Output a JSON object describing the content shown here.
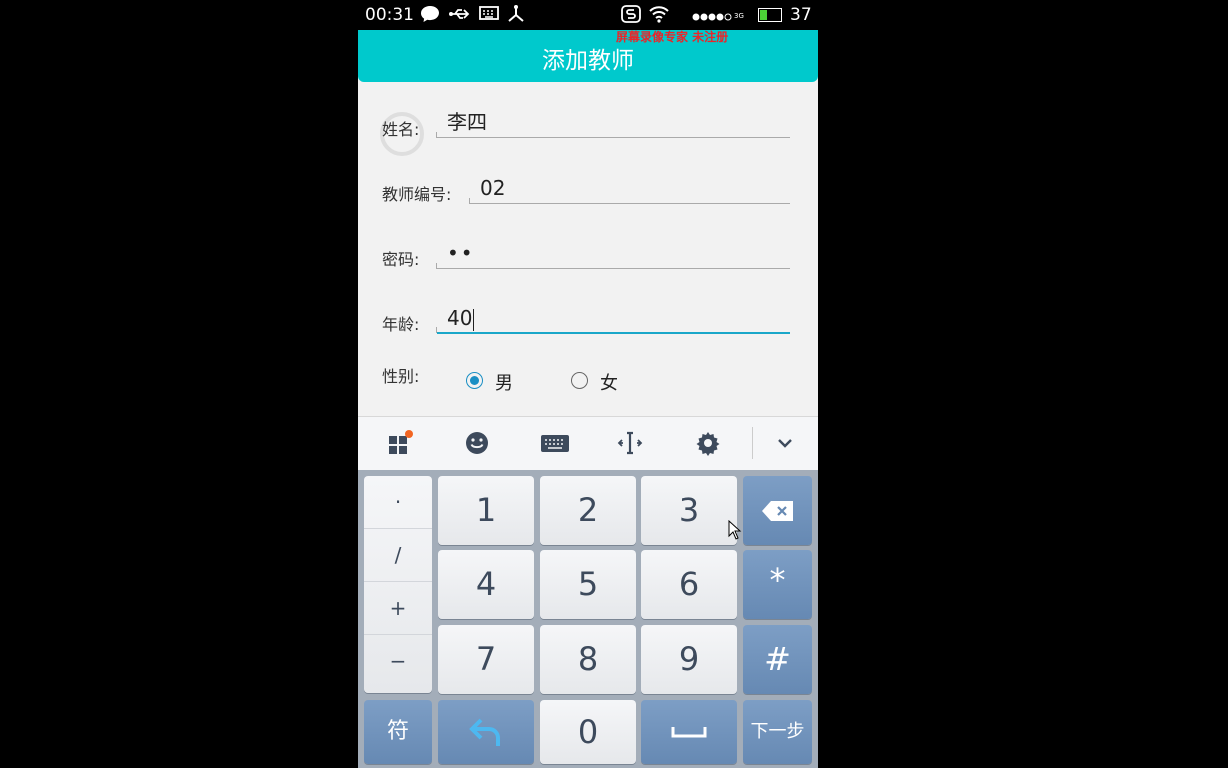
{
  "status_bar": {
    "time": "00:31",
    "battery": "37",
    "battery_level": 0.37,
    "signal_label": "3G"
  },
  "app": {
    "title": "添加教师",
    "watermark": "屏幕录像专家 未注册"
  },
  "form": {
    "name_label": "姓名:",
    "name_value": "李四",
    "id_label": "教师编号:",
    "id_value": "02",
    "password_label": "密码:",
    "password_value": "••",
    "age_label": "年龄:",
    "age_value": "40",
    "gender_label": "性别:",
    "gender_male": "男",
    "gender_female": "女",
    "gender_selected": "男"
  },
  "keyboard": {
    "symbols": [
      "·",
      "/",
      "+",
      "−"
    ],
    "digits": [
      "1",
      "2",
      "3",
      "4",
      "5",
      "6",
      "7",
      "8",
      "9",
      "0"
    ],
    "star": "*",
    "hash": "#",
    "sym_key": "符",
    "next_key": "下一步"
  },
  "colors": {
    "accent": "#00c9cc",
    "radio": "#1a8fc4",
    "watermark": "#e8262a"
  }
}
